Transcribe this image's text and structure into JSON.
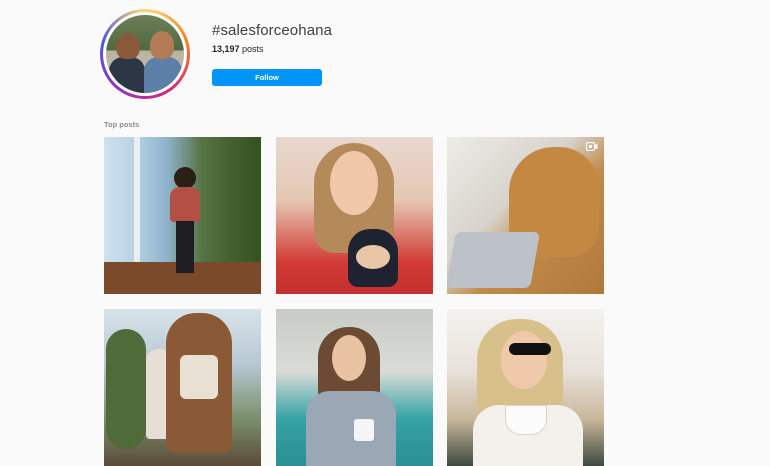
{
  "header": {
    "hashtag": "#salesforceohana",
    "post_count": "13,197",
    "posts_word": "posts",
    "follow_label": "Follow"
  },
  "sections": {
    "top_posts_label": "Top posts"
  },
  "posts": [
    {
      "kind": "photo"
    },
    {
      "kind": "photo"
    },
    {
      "kind": "video",
      "icon": "video-camera-icon"
    },
    {
      "kind": "photo"
    },
    {
      "kind": "photo"
    },
    {
      "kind": "photo"
    }
  ],
  "colors": {
    "background": "#fafafa",
    "follow_button": "#0095f6",
    "secondary_text": "#8e8e8e"
  }
}
